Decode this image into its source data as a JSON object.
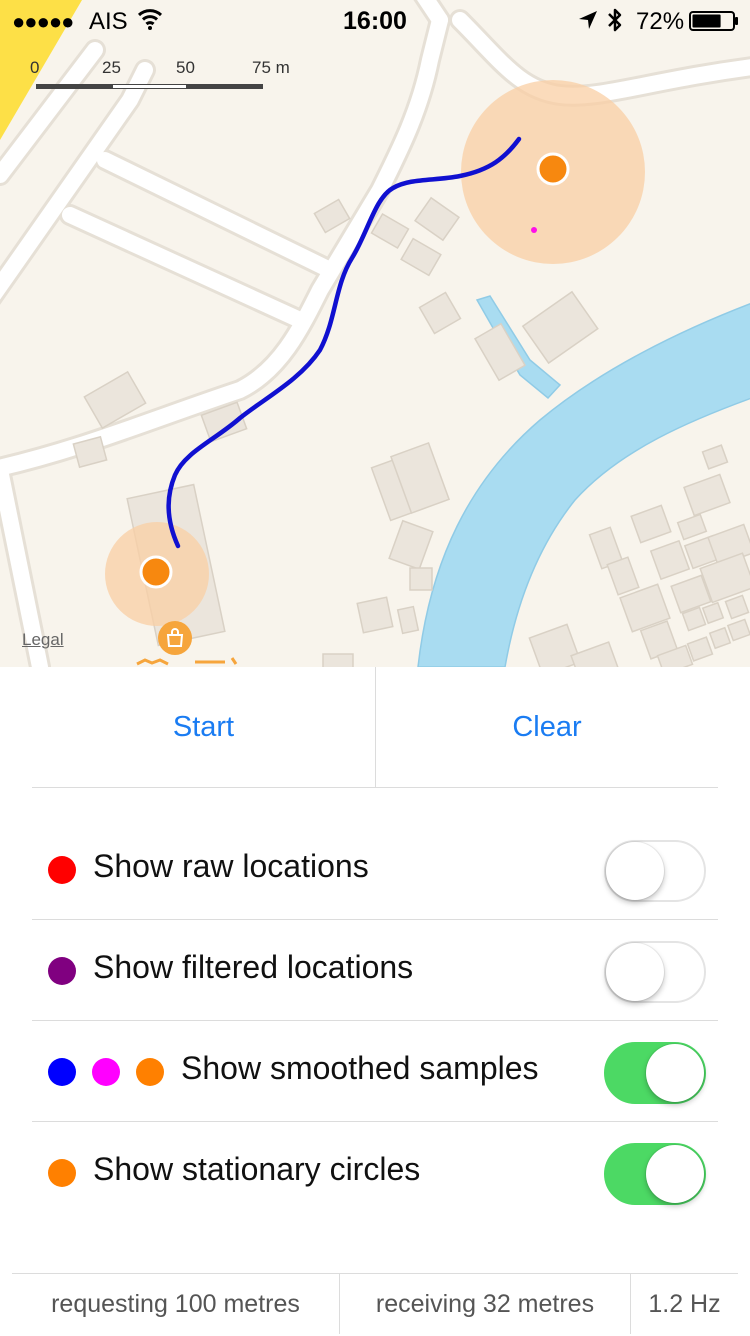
{
  "status_bar": {
    "signal": "●●●●●",
    "carrier": "AIS",
    "time": "16:00",
    "battery_percent": "72%",
    "battery_level": 0.72,
    "icons": [
      "signal-icon",
      "wifi-icon",
      "location-arrow-icon",
      "bluetooth-icon",
      "battery-icon"
    ]
  },
  "map": {
    "scale": {
      "labels": [
        "0",
        "25",
        "50",
        "75 m"
      ]
    },
    "legal": "Legal",
    "poi_icon": "shopping-bag-icon",
    "colors": {
      "land": "#f8f4ec",
      "road": "#ffffff",
      "water": "#a9dcf1",
      "building": "#ebe5dc",
      "track": "#1010d0",
      "stationary_circle": "#f9cfa4",
      "sample_marker": "#f7880f",
      "magenta_sample": "#ff10e8",
      "park": "#fde047"
    }
  },
  "buttons": {
    "start": "Start",
    "clear": "Clear"
  },
  "options": [
    {
      "label": "Show raw locations",
      "dots": [
        "#ff0000"
      ],
      "enabled": false
    },
    {
      "label": "Show filtered locations",
      "dots": [
        "#800080"
      ],
      "enabled": false
    },
    {
      "label": "Show smoothed samples",
      "dots": [
        "#0000ff",
        "#ff00ff",
        "#ff8000"
      ],
      "enabled": true
    },
    {
      "label": "Show stationary circles",
      "dots": [
        "#ff8000"
      ],
      "enabled": true
    }
  ],
  "footer": {
    "requesting": "requesting 100 metres",
    "receiving": "receiving 32 metres",
    "frequency": "1.2 Hz"
  }
}
